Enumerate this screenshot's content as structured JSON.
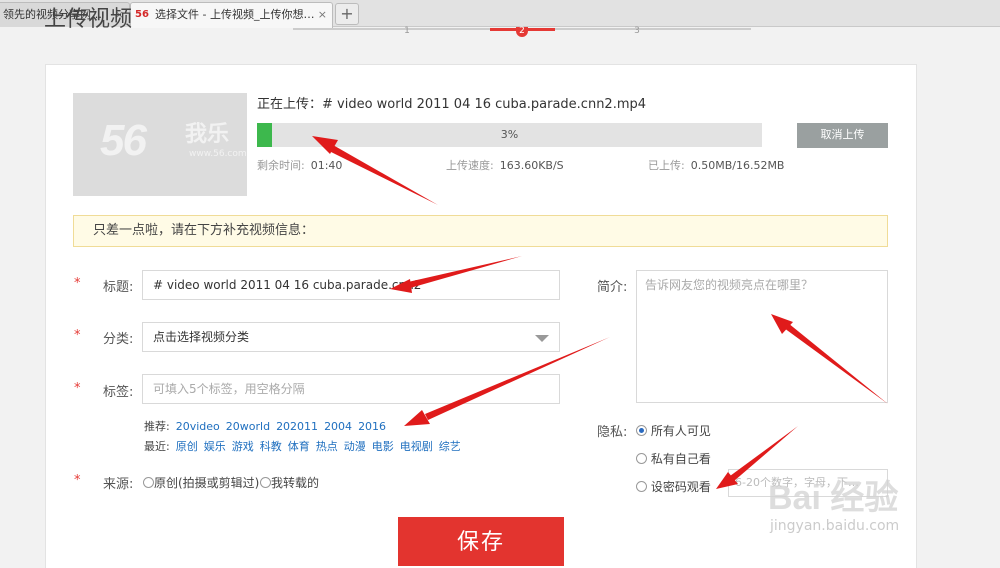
{
  "browser": {
    "tabs": [
      {
        "label": "领先的视频分享网…",
        "close": "×"
      },
      {
        "favicon": "56",
        "label": "选择文件 - 上传视频_上传你想…",
        "close": "×"
      }
    ],
    "new_tab": "+"
  },
  "stepper": {
    "heading": "上传视频",
    "steps": [
      "1",
      "2",
      "3"
    ],
    "active_step": 2
  },
  "thumbnail": {
    "logo": "56",
    "logo_cn": "我乐",
    "logo_url": "www.56.com"
  },
  "upload": {
    "status_label": "正在上传：# video world 2011 04 16 cuba.parade.cnn2.mp4",
    "progress_percent": 3,
    "progress_text": "3%",
    "cancel_label": "取消上传",
    "time_left_label": "剩余时间:",
    "time_left_value": "01:40",
    "speed_label": "上传速度:",
    "speed_value": "163.60KB/S",
    "uploaded_label": "已上传:",
    "uploaded_value": "0.50MB/16.52MB"
  },
  "notice": "只差一点啦，请在下方补充视频信息：",
  "form": {
    "required_mark": "*",
    "title_label": "标题:",
    "title_value": "# video world 2011 04 16 cuba.parade.cnn2",
    "category_label": "分类:",
    "category_value": "点击选择视频分类",
    "tags_label": "标签:",
    "tags_placeholder": "可填入5个标签，用空格分隔",
    "recommend_label": "推荐:",
    "recommend_tags": [
      "20video",
      "20world",
      "202011",
      "2004",
      "2016"
    ],
    "recent_label": "最近:",
    "recent_tags": [
      "原创",
      "娱乐",
      "游戏",
      "科教",
      "体育",
      "热点",
      "动漫",
      "电影",
      "电视剧",
      "综艺"
    ],
    "source_label": "来源:",
    "source_options": [
      "原创(拍摄或剪辑过)",
      "我转载的"
    ],
    "desc_label": "简介:",
    "desc_placeholder": "告诉网友您的视频亮点在哪里？",
    "privacy_label": "隐私:",
    "privacy_options": [
      "所有人可见",
      "私有自己看",
      "设密码观看"
    ],
    "privacy_selected": 0,
    "password_placeholder": "6-20个数字，字母，下…",
    "save_label": "保存"
  },
  "watermark": {
    "brand": "Bai 经验",
    "url": "jingyan.baidu.com"
  },
  "colors": {
    "accent": "#e3342f",
    "progress": "#3db84d",
    "link": "#1f6fbf",
    "annotation": "#e01b1b"
  }
}
